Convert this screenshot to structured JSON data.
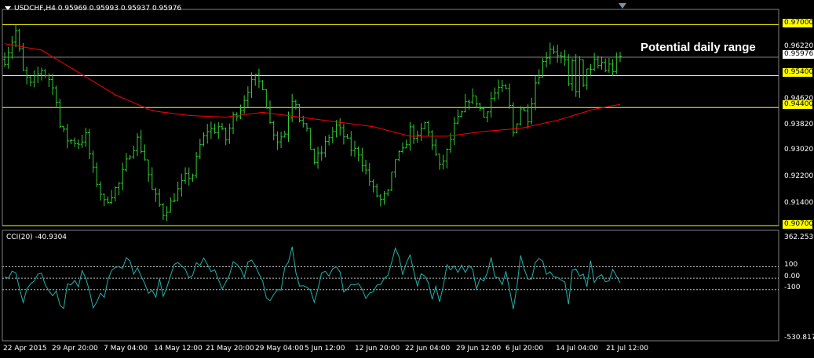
{
  "chart_header": {
    "symbol_label": "USDCHF,H4",
    "ohlc": "0.95969 0.95993 0.95937 0.95976"
  },
  "annotation": "Potential daily range",
  "price_axis": {
    "labels": [
      "0.97000",
      "0.96220",
      "0.95976",
      "0.95400",
      "0.94620",
      "0.94400",
      "0.93820",
      "0.93020",
      "0.92200",
      "0.91400",
      "0.90700"
    ],
    "highlighted": [
      "0.97000",
      "0.95400",
      "0.94400",
      "0.90700"
    ]
  },
  "indicator": {
    "title": "CCI(20) -40.9304",
    "axis_labels": [
      "362.2539",
      "100",
      "0.00",
      "-100",
      "-530.8174"
    ]
  },
  "time_axis": {
    "labels": [
      "22 Apr 2015",
      "29 Apr 20:00",
      "7 May 04:00",
      "14 May 12:00",
      "21 May 20:00",
      "29 May 04:00",
      "5 Jun 12:00",
      "12 Jun 20:00",
      "22 Jun 04:00",
      "29 Jun 12:00",
      "6 Jul 20:00",
      "14 Jul 04:00",
      "21 Jul 12:00"
    ]
  },
  "colors": {
    "background": "#000000",
    "bars": "#32cd32",
    "moving_average": "#ff0000",
    "level_lines": "#ffff00",
    "current_price_line": "#808080",
    "cci_line": "#20b2aa",
    "axis_text": "#ffffff"
  },
  "chart_data": {
    "type": "ohlc",
    "title": "USDCHF,H4",
    "price_range": [
      0.907,
      0.9718
    ],
    "horizontal_levels": [
      0.97,
      0.954,
      0.944,
      0.907
    ],
    "current_price": 0.95976,
    "close_path": [
      [
        0,
        0.959
      ],
      [
        3,
        0.968
      ],
      [
        5,
        0.955
      ],
      [
        7,
        0.951
      ],
      [
        10,
        0.956
      ],
      [
        12,
        0.953
      ],
      [
        14,
        0.947
      ],
      [
        15,
        0.938
      ],
      [
        17,
        0.934
      ],
      [
        20,
        0.933
      ],
      [
        22,
        0.935
      ],
      [
        24,
        0.924
      ],
      [
        27,
        0.914
      ],
      [
        29,
        0.917
      ],
      [
        31,
        0.92
      ],
      [
        34,
        0.93
      ],
      [
        36,
        0.934
      ],
      [
        38,
        0.928
      ],
      [
        40,
        0.918
      ],
      [
        43,
        0.911
      ],
      [
        45,
        0.914
      ],
      [
        47,
        0.918
      ],
      [
        49,
        0.922
      ],
      [
        51,
        0.923
      ],
      [
        53,
        0.932
      ],
      [
        55,
        0.937
      ],
      [
        57,
        0.937
      ],
      [
        58,
        0.938
      ],
      [
        60,
        0.934
      ],
      [
        62,
        0.941
      ],
      [
        64,
        0.944
      ],
      [
        66,
        0.95
      ],
      [
        68,
        0.953
      ],
      [
        70,
        0.951
      ],
      [
        72,
        0.939
      ],
      [
        74,
        0.934
      ],
      [
        76,
        0.936
      ],
      [
        78,
        0.947
      ],
      [
        79,
        0.946
      ],
      [
        80,
        0.941
      ],
      [
        82,
        0.936
      ],
      [
        84,
        0.927
      ],
      [
        86,
        0.93
      ],
      [
        88,
        0.935
      ],
      [
        90,
        0.938
      ],
      [
        92,
        0.935
      ],
      [
        94,
        0.931
      ],
      [
        96,
        0.93
      ],
      [
        98,
        0.924
      ],
      [
        100,
        0.918
      ],
      [
        102,
        0.915
      ],
      [
        104,
        0.917
      ],
      [
        106,
        0.928
      ],
      [
        108,
        0.93
      ],
      [
        110,
        0.937
      ],
      [
        112,
        0.934
      ],
      [
        114,
        0.939
      ],
      [
        116,
        0.933
      ],
      [
        118,
        0.925
      ],
      [
        120,
        0.93
      ],
      [
        122,
        0.938
      ],
      [
        124,
        0.942
      ],
      [
        126,
        0.947
      ],
      [
        128,
        0.946
      ],
      [
        130,
        0.941
      ],
      [
        132,
        0.947
      ],
      [
        134,
        0.95
      ],
      [
        136,
        0.949
      ],
      [
        137,
        0.944
      ],
      [
        138,
        0.936
      ],
      [
        140,
        0.944
      ],
      [
        142,
        0.941
      ],
      [
        144,
        0.952
      ],
      [
        146,
        0.958
      ],
      [
        148,
        0.963
      ],
      [
        150,
        0.961
      ],
      [
        152,
        0.958
      ],
      [
        153,
        0.95
      ],
      [
        154,
        0.958
      ],
      [
        155,
        0.95
      ],
      [
        156,
        0.958
      ],
      [
        157,
        0.95
      ],
      [
        158,
        0.957
      ],
      [
        159,
        0.955
      ],
      [
        160,
        0.958
      ],
      [
        161,
        0.957
      ],
      [
        162,
        0.958
      ],
      [
        163,
        0.956
      ],
      [
        164,
        0.957
      ],
      [
        165,
        0.956
      ],
      [
        166,
        0.9585
      ],
      [
        167,
        0.9597
      ]
    ],
    "moving_average_path": [
      [
        0,
        0.964
      ],
      [
        10,
        0.962
      ],
      [
        20,
        0.955
      ],
      [
        30,
        0.948
      ],
      [
        40,
        0.943
      ],
      [
        50,
        0.9415
      ],
      [
        60,
        0.941
      ],
      [
        70,
        0.9425
      ],
      [
        80,
        0.941
      ],
      [
        90,
        0.9395
      ],
      [
        100,
        0.938
      ],
      [
        110,
        0.935
      ],
      [
        120,
        0.935
      ],
      [
        130,
        0.9365
      ],
      [
        140,
        0.9375
      ],
      [
        150,
        0.94
      ],
      [
        160,
        0.9435
      ],
      [
        167,
        0.945
      ]
    ],
    "cci": {
      "range": [
        -530.8174,
        362.2539
      ],
      "levels": [
        100,
        0,
        -100
      ],
      "last_value": -40.9304
    }
  }
}
